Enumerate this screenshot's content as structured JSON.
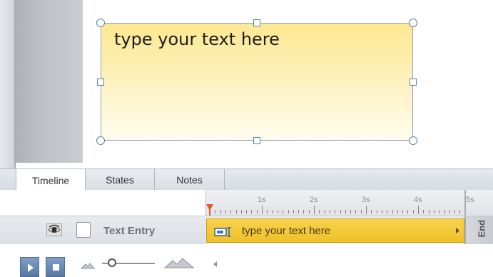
{
  "stage": {
    "caption_text": "type your text here"
  },
  "tabs": [
    {
      "label": "Timeline",
      "active": true
    },
    {
      "label": "States",
      "active": false
    },
    {
      "label": "Notes",
      "active": false
    }
  ],
  "ruler": {
    "tick_labels": [
      "1s",
      "2s",
      "3s",
      "4s",
      "5s"
    ]
  },
  "track": {
    "name": "Text Entry",
    "bar_label": "type your text here",
    "end_label": "End"
  },
  "colors": {
    "track_bar": "#f2c633",
    "playhead": "#e8581c",
    "caption_fill": "#fde890",
    "play_button": "#6a8ab5"
  },
  "icons": {
    "visibility": "eye-icon",
    "lock": "lock-checkbox-icon",
    "text_entry": "text-entry-icon",
    "play": "play-icon",
    "stop": "stop-icon",
    "zoom_out": "mountain-small-icon",
    "zoom_in": "mountain-large-icon"
  }
}
